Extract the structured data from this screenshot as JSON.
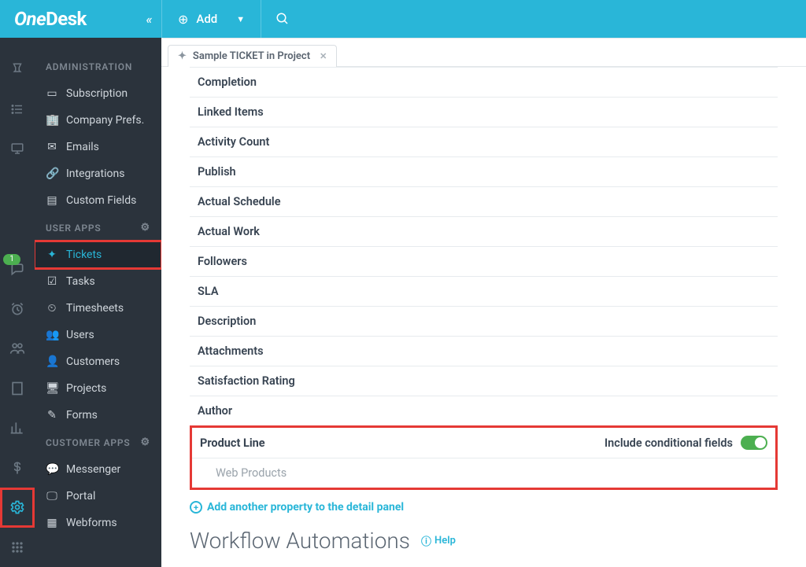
{
  "brand": {
    "name_a": "One",
    "name_b": "Desk"
  },
  "topbar": {
    "add_label": "Add"
  },
  "tab": {
    "label": "Sample TICKET in Project"
  },
  "admin": {
    "title": "ADMINISTRATION",
    "items": {
      "subscription": "Subscription",
      "company_prefs": "Company Prefs.",
      "emails": "Emails",
      "integrations": "Integrations",
      "custom_fields": "Custom Fields"
    }
  },
  "userapps": {
    "title": "USER APPS",
    "items": {
      "tickets": "Tickets",
      "tasks": "Tasks",
      "timesheets": "Timesheets",
      "users": "Users",
      "customers": "Customers",
      "projects": "Projects",
      "forms": "Forms"
    }
  },
  "customerapps": {
    "title": "CUSTOMER APPS",
    "items": {
      "messenger": "Messenger",
      "portal": "Portal",
      "webforms": "Webforms"
    }
  },
  "properties": {
    "list": {
      "completion": "Completion",
      "linked_items": "Linked Items",
      "activity_count": "Activity Count",
      "publish": "Publish",
      "actual_schedule": "Actual Schedule",
      "actual_work": "Actual Work",
      "followers": "Followers",
      "sla": "SLA",
      "description": "Description",
      "attachments": "Attachments",
      "satisfaction_rating": "Satisfaction Rating",
      "author": "Author"
    },
    "highlight": {
      "label": "Product Line",
      "conditional_label": "Include conditional fields",
      "sub": "Web Products"
    },
    "add_label": "Add another property to the detail panel"
  },
  "workflow": {
    "title": "Workflow Automations",
    "help": "Help"
  },
  "badge_count": "1"
}
